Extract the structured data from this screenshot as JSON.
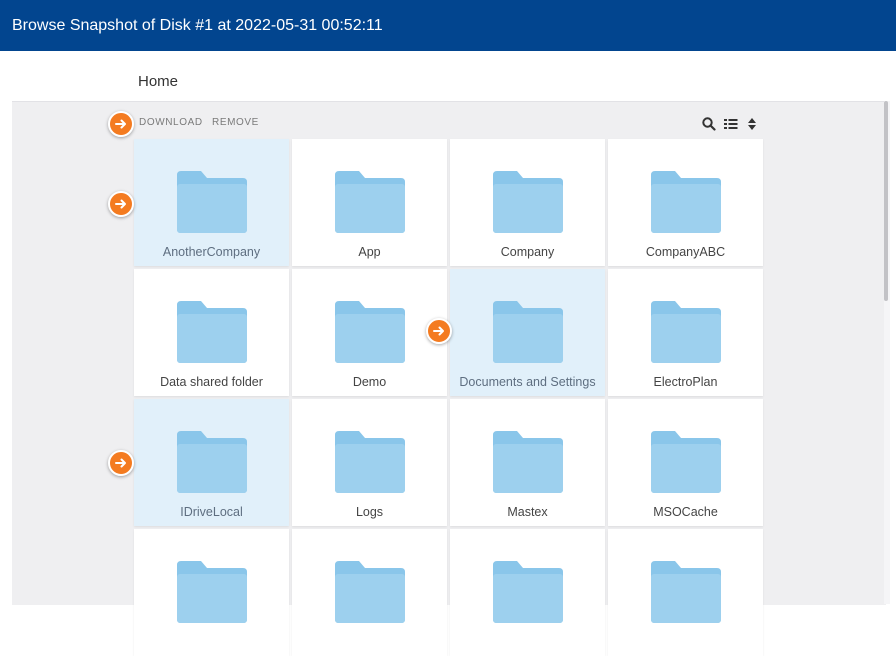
{
  "window": {
    "title_prefix": "Browse",
    "title_snapshot": "Snapshot of Disk #1",
    "title_mid": "at",
    "title_time": "2022-05-31 00:52:11"
  },
  "breadcrumb": {
    "home": "Home"
  },
  "toolbar": {
    "download": "DOWNLOAD",
    "remove": "REMOVE"
  },
  "folders": [
    {
      "name": "AnotherCompany",
      "selected": true
    },
    {
      "name": "App",
      "selected": false
    },
    {
      "name": "Company",
      "selected": false
    },
    {
      "name": "CompanyABC",
      "selected": false
    },
    {
      "name": "Data shared folder",
      "selected": false
    },
    {
      "name": "Demo",
      "selected": false
    },
    {
      "name": "Documents and Settings",
      "selected": true
    },
    {
      "name": "ElectroPlan",
      "selected": false
    },
    {
      "name": "IDriveLocal",
      "selected": true
    },
    {
      "name": "Logs",
      "selected": false
    },
    {
      "name": "Mastex",
      "selected": false
    },
    {
      "name": "MSOCache",
      "selected": false
    },
    {
      "name": "",
      "selected": false
    },
    {
      "name": "",
      "selected": false
    },
    {
      "name": "",
      "selected": false
    },
    {
      "name": "",
      "selected": false
    }
  ],
  "icons": {
    "folder": "folder-icon",
    "search": "search-icon",
    "list_view": "list-view-icon",
    "sort": "sort-icon",
    "pointer": "arrow-right-icon"
  },
  "colors": {
    "header": "#02458f",
    "folder": "#9dd0ee",
    "folder_tab": "#8ac6ea",
    "selected_tile": "#e1f0fa",
    "marker": "#f47b20"
  }
}
